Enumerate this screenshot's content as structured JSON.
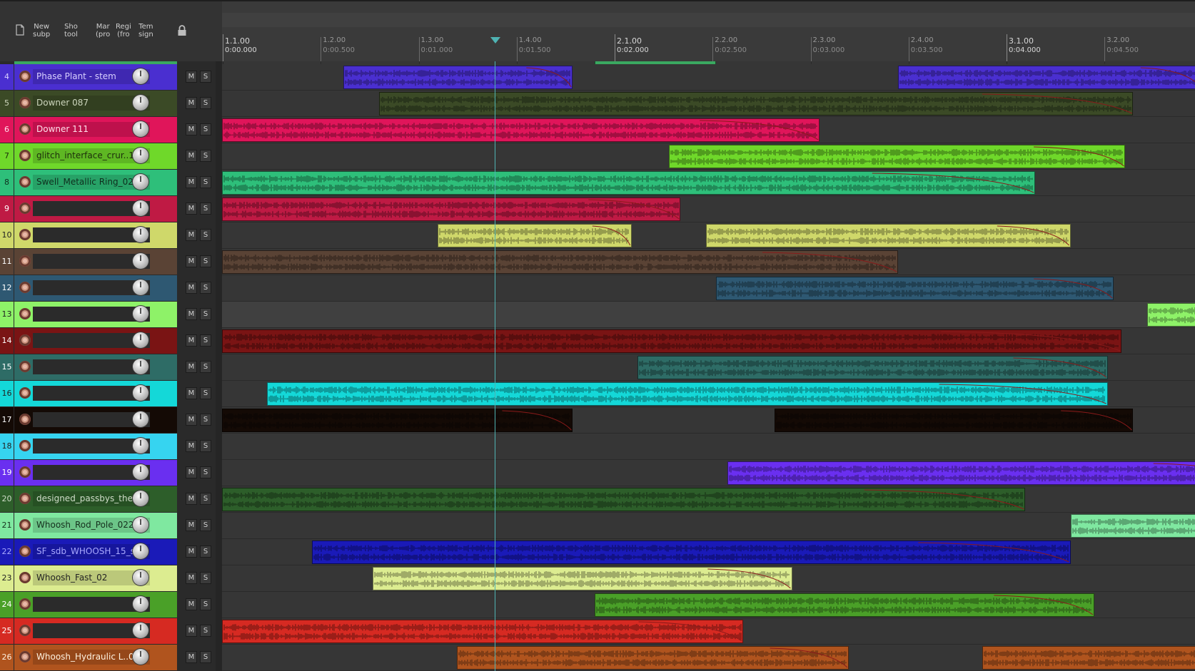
{
  "toolbar": {
    "items": [
      {
        "id": "new-subproject",
        "line1": "New",
        "line2": "subp"
      },
      {
        "id": "show-toolbar",
        "line1": "Sho",
        "line2": "tool"
      },
      {
        "id": "markers",
        "line1": "Mar",
        "line2": "(pro"
      },
      {
        "id": "regions",
        "line1": "Regi",
        "line2": "(fro"
      },
      {
        "id": "tempo-signature",
        "line1": "Tem",
        "line2": "sign"
      }
    ],
    "icons": {
      "document": "document-icon",
      "lock": "lock-icon"
    }
  },
  "ruler": {
    "marks": [
      {
        "bar": "1.1.00",
        "time": "0:00.000",
        "major": true
      },
      {
        "bar": "1.2.00",
        "time": "0:00.500",
        "major": false
      },
      {
        "bar": "1.3.00",
        "time": "0:01.000",
        "major": false
      },
      {
        "bar": "1.4.00",
        "time": "0:01.500",
        "major": false
      },
      {
        "bar": "2.1.00",
        "time": "0:02.000",
        "major": true
      },
      {
        "bar": "2.2.00",
        "time": "0:02.500",
        "major": false
      },
      {
        "bar": "2.3.00",
        "time": "0:03.000",
        "major": false
      },
      {
        "bar": "2.4.00",
        "time": "0:03.500",
        "major": false
      },
      {
        "bar": "3.1.00",
        "time": "0:04.000",
        "major": true
      },
      {
        "bar": "3.2.00",
        "time": "0:04.500",
        "major": false
      }
    ],
    "playhead_seconds": 1.39
  },
  "mixer_labels": {
    "mute": "M",
    "solo": "S"
  },
  "tracks": [
    {
      "num": "4",
      "name": "Phase Plant - stem",
      "color": "#4a2fd0",
      "text": "#d8d0ff",
      "items": [
        [
          0.62,
          1.79
        ],
        [
          3.45,
          5.0
        ]
      ]
    },
    {
      "num": "5",
      "name": "Downer 087",
      "color": "#3b4a26",
      "text": "#cdd6bd",
      "items": [
        [
          0.8,
          4.65
        ],
        [
          5.14,
          9.61
        ]
      ]
    },
    {
      "num": "6",
      "name": "Downer 111",
      "color": "#e0155a",
      "text": "#ffe0ea",
      "items": [
        [
          0.0,
          3.05
        ]
      ]
    },
    {
      "num": "7",
      "name": "glitch_interface_crur..12",
      "color": "#6fd82a",
      "text": "#1d2e0c",
      "items": [
        [
          2.28,
          4.61
        ]
      ]
    },
    {
      "num": "8",
      "name": "Swell_Metallic Ring_02",
      "color": "#2ebf7a",
      "text": "#0f2e1e",
      "items": [
        [
          0.0,
          4.15
        ],
        [
          5.01,
          9.21
        ]
      ]
    },
    {
      "num": "9",
      "name": "",
      "color": "#bf1a44",
      "text": "#ffffff",
      "items": [
        [
          0.0,
          2.34
        ]
      ]
    },
    {
      "num": "10",
      "name": "",
      "color": "#cfd86a",
      "text": "#222222",
      "items": [
        [
          1.1,
          2.09
        ],
        [
          2.47,
          4.33
        ]
      ]
    },
    {
      "num": "11",
      "name": "",
      "color": "#5a4335",
      "text": "#ffffff",
      "items": [
        [
          0.0,
          3.45
        ]
      ]
    },
    {
      "num": "12",
      "name": "",
      "color": "#2e5872",
      "text": "#ffffff",
      "items": [
        [
          2.52,
          4.55
        ],
        [
          5.11,
          9.25
        ]
      ]
    },
    {
      "num": "13",
      "name": "",
      "color": "#8ef268",
      "text": "#222222",
      "items": [
        [
          4.72,
          8.84
        ]
      ]
    },
    {
      "num": "14",
      "name": "",
      "color": "#7a1414",
      "text": "#ffffff",
      "items": [
        [
          0.0,
          4.59
        ]
      ]
    },
    {
      "num": "15",
      "name": "",
      "color": "#2e6c66",
      "text": "#ffffff",
      "items": [
        [
          2.12,
          4.52
        ]
      ]
    },
    {
      "num": "16",
      "name": "",
      "color": "#14d8d8",
      "text": "#222222",
      "items": [
        [
          0.23,
          4.52
        ]
      ]
    },
    {
      "num": "17",
      "name": "",
      "color": "#140a05",
      "text": "#ffffff",
      "items": [
        [
          0.0,
          1.79
        ],
        [
          2.82,
          4.65
        ]
      ]
    },
    {
      "num": "18",
      "name": "",
      "color": "#36d4f0",
      "text": "#222222",
      "items": [
        [
          5.03,
          9.84
        ]
      ]
    },
    {
      "num": "19",
      "name": "",
      "color": "#6a2ff0",
      "text": "#ffffff",
      "items": [
        [
          2.58,
          5.3
        ]
      ]
    },
    {
      "num": "20",
      "name": "designed_passbys_the..2",
      "color": "#2d5e2a",
      "text": "#cfdcc8",
      "items": [
        [
          0.0,
          4.1
        ]
      ]
    },
    {
      "num": "21",
      "name": "Whoosh_Rod_Pole_022",
      "color": "#7fe8a0",
      "text": "#15301e",
      "items": [
        [
          4.33,
          6.76
        ]
      ]
    },
    {
      "num": "22",
      "name": "SF_sdb_WHOOSH_15_sp",
      "color": "#1a1ab8",
      "text": "#a8a8ff",
      "items": [
        [
          0.46,
          4.33
        ]
      ]
    },
    {
      "num": "23",
      "name": "Whoosh_Fast_02",
      "color": "#dcec90",
      "text": "#222222",
      "items": [
        [
          0.77,
          2.91
        ]
      ]
    },
    {
      "num": "24",
      "name": "",
      "color": "#4aa028",
      "text": "#ffffff",
      "items": [
        [
          1.9,
          4.45
        ]
      ]
    },
    {
      "num": "25",
      "name": "",
      "color": "#d62a22",
      "text": "#ffffff",
      "items": [
        [
          0.0,
          2.66
        ]
      ]
    },
    {
      "num": "26",
      "name": "Whoosh_Hydraulic L..01",
      "color": "#b0541e",
      "text": "#fff2e0",
      "items": [
        [
          1.2,
          3.2
        ],
        [
          3.88,
          5.88
        ]
      ]
    }
  ]
}
